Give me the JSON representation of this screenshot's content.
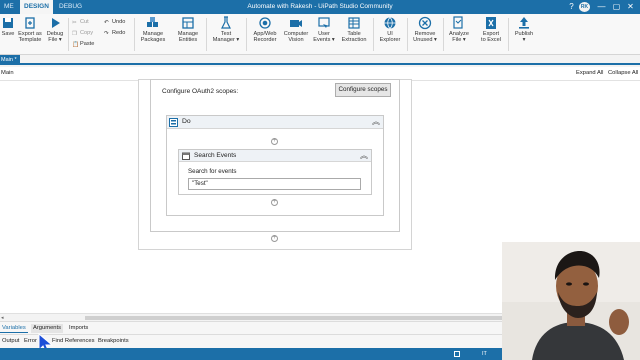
{
  "titlebar": {
    "tabs": [
      "ME",
      "DESIGN",
      "DEBUG"
    ],
    "window_title": "Automate with Rakesh - UiPath Studio Community",
    "avatar": "RK",
    "controls": [
      "?",
      "—",
      "▢",
      "✕"
    ]
  },
  "ribbon": {
    "save": "Save",
    "export_template": [
      "Export as",
      "Template"
    ],
    "debug_file": [
      "Debug",
      "File ▾"
    ],
    "cut": "Cut",
    "copy": "Copy",
    "paste": "Paste",
    "undo": "Undo",
    "redo": "Redo",
    "manage_packages": [
      "Manage",
      "Packages"
    ],
    "manage_entities": [
      "Manage",
      "Entities"
    ],
    "test_manager": [
      "Test",
      "Manager ▾"
    ],
    "recorder": [
      "App/Web",
      "Recorder"
    ],
    "computer_vision": [
      "Computer",
      "Vision"
    ],
    "user_events": [
      "User",
      "Events ▾"
    ],
    "table_extraction": [
      "Table",
      "Extraction"
    ],
    "ui_explorer": [
      "UI",
      "Explorer"
    ],
    "remove_unused": [
      "Remove",
      "Unused ▾"
    ],
    "analyze_file": [
      "Analyze",
      "File ▾"
    ],
    "export_excel": [
      "Export",
      "to Excel"
    ],
    "publish": [
      "Publish",
      "▾"
    ]
  },
  "doc_tab": "Main *",
  "breadcrumb": "Main",
  "actions": {
    "expand_all": "Expand All",
    "collapse_all": "Collapse All"
  },
  "canvas": {
    "oauth_label": "Configure OAuth2 scopes:",
    "oauth_button": "Configure scopes",
    "do_title": "Do",
    "search_events_title": "Search Events",
    "search_label": "Search for events",
    "search_value": "\"Test\""
  },
  "bottom": {
    "row1": [
      "Variables",
      "Arguments",
      "Imports"
    ],
    "row2": [
      "Output",
      "Error L",
      "Find References",
      "Breakpoints"
    ],
    "status_lang": "IT"
  },
  "colors": {
    "accent": "#1c6fa8",
    "canvas": "#ffffff",
    "ribbon": "#f8f8f8"
  }
}
